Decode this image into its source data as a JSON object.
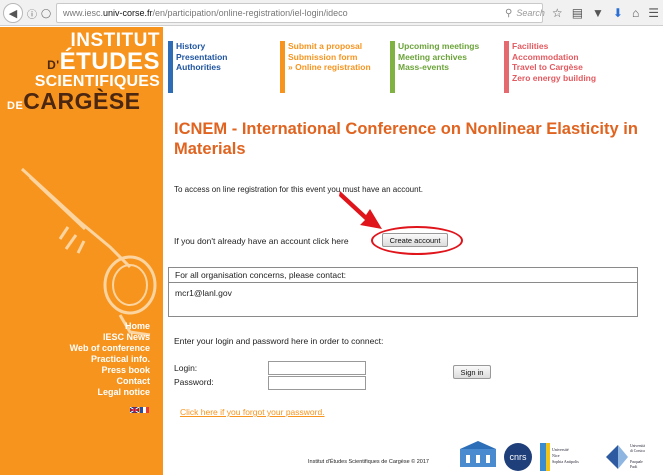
{
  "browser": {
    "url_prefix": "www.iesc.",
    "url_domain": "univ-corse.fr",
    "url_path": "/en/participation/online-registration/iel-login/ideco",
    "search_placeholder": "Search"
  },
  "logo": {
    "line1": "INSTITUT",
    "line2_prefix": "D'",
    "line2": "ÉTUDES",
    "line3": "SCIENTIFIQUES",
    "line4_prefix": "DE",
    "line4": "CARGÈSE"
  },
  "top_nav": [
    {
      "items": [
        "History",
        "Presentation",
        "Authorities"
      ],
      "color": "#2e6db5",
      "text_color": "#1f55a0"
    },
    {
      "items": [
        "Submit a proposal",
        "Submission form",
        "» Online registration"
      ],
      "color": "#f7941d",
      "text_color": "#f7941d"
    },
    {
      "items": [
        "Upcoming meetings",
        "Meeting archives",
        "Mass-events"
      ],
      "color": "#7fb241",
      "text_color": "#6aa338"
    },
    {
      "items": [
        "Facilities",
        "Accommodation",
        "Travel to Cargèse",
        "Zero energy building"
      ],
      "color": "#e46a6f",
      "text_color": "#e35a60"
    }
  ],
  "side_nav": [
    "Home",
    "IESC News",
    "Web of conference",
    "Practical info.",
    "Press book",
    "Contact",
    "Legal notice"
  ],
  "main": {
    "title": "ICNEM - International Conference on Nonlinear Elasticity in Materials",
    "intro": "To access on line registration for this event you must have an account.",
    "account_prompt": "If you don't already have an account click here",
    "create_account_label": "Create account",
    "contact_heading": "For all organisation concerns, please contact:",
    "contact_email": "mcr1@lanl.gov",
    "login_prompt": "Enter your login and password here in order to connect:",
    "login_label": "Login:",
    "password_label": "Password:",
    "signin_label": "Sign in",
    "forgot_link": "Click here if you forgot your password."
  },
  "footer": {
    "copyright": "Institut d'Études Scientifiques de Cargèse © 2017",
    "logo_cnrs": "cnrs",
    "logo_uns_1": "Université",
    "logo_uns_2": "Nice",
    "logo_uns_3": "Sophia Antipolis",
    "logo_corse_1": "Università",
    "logo_corse_2": "di Corsica",
    "logo_corse_3": "Pasquale",
    "logo_corse_4": "Paoli"
  },
  "colors": {
    "sidebar": "#f7941d",
    "title": "#e06420",
    "annotation": "#e0141b"
  }
}
